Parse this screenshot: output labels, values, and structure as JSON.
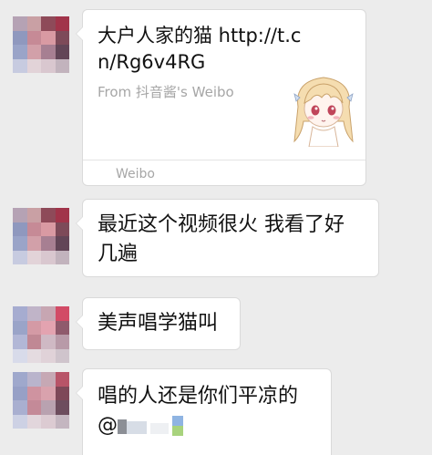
{
  "messages": [
    {
      "type": "link_card",
      "title": "大户人家的猫 http://t.cn/Rg6v4RG",
      "source": "From 抖音酱's Weibo",
      "footer_app": "Weibo"
    },
    {
      "type": "text",
      "text": "最近这个视频很火 我看了好几遍"
    },
    {
      "type": "text",
      "text": "美声唱学猫叫"
    },
    {
      "type": "text",
      "text": "唱的人还是你们平凉的",
      "mention": "@"
    }
  ],
  "colors": {
    "background": "#ececec",
    "bubble": "#ffffff",
    "bubble_border": "#dadada",
    "secondary_text": "#a6a6a6"
  }
}
